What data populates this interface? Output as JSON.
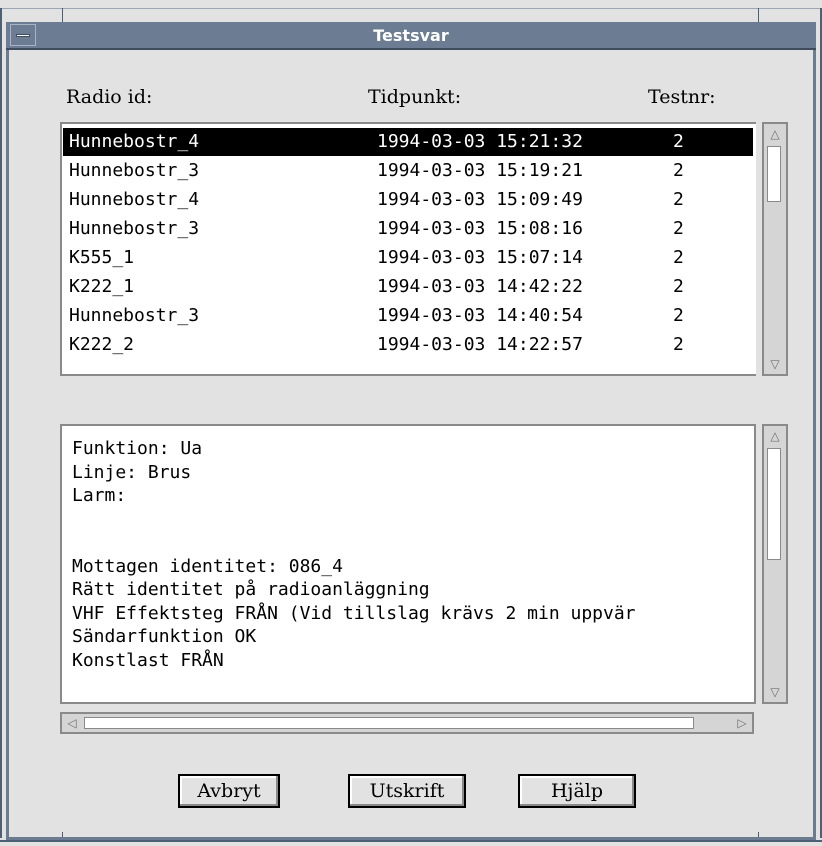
{
  "window": {
    "title": "Testsvar"
  },
  "headers": {
    "radio_id": "Radio id:",
    "tidpunkt": "Tidpunkt:",
    "testnr": "Testnr:"
  },
  "list": {
    "rows": [
      {
        "radio": "Hunnebostr_4",
        "time": "1994-03-03 15:21:32",
        "nr": "2",
        "selected": true
      },
      {
        "radio": "Hunnebostr_3",
        "time": "1994-03-03 15:19:21",
        "nr": "2"
      },
      {
        "radio": "Hunnebostr_4",
        "time": "1994-03-03 15:09:49",
        "nr": "2"
      },
      {
        "radio": "Hunnebostr_3",
        "time": "1994-03-03 15:08:16",
        "nr": "2"
      },
      {
        "radio": "K555_1",
        "time": "1994-03-03 15:07:14",
        "nr": "2"
      },
      {
        "radio": "K222_1",
        "time": "1994-03-03 14:42:22",
        "nr": "2"
      },
      {
        "radio": "Hunnebostr_3",
        "time": "1994-03-03 14:40:54",
        "nr": "2"
      },
      {
        "radio": "K222_2",
        "time": "1994-03-03 14:22:57",
        "nr": "2"
      }
    ]
  },
  "details": {
    "lines": [
      "Funktion: Ua",
      "Linje: Brus",
      "Larm:",
      "",
      "",
      "Mottagen identitet: 086_4",
      "Rätt identitet på radioanläggning",
      "VHF Effektsteg FRÅN (Vid tillslag krävs 2 min uppvär",
      "Sändarfunktion OK",
      "Konstlast FRÅN"
    ]
  },
  "buttons": {
    "cancel": "Avbryt",
    "print": "Utskrift",
    "help": "Hjälp"
  }
}
